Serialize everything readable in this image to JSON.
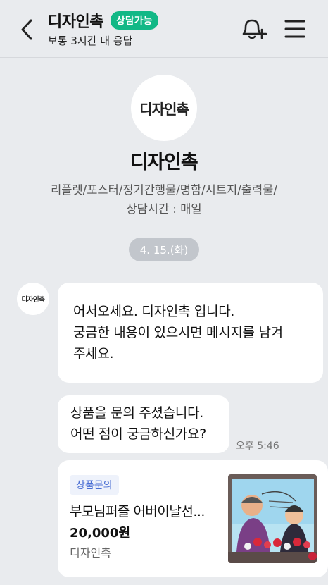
{
  "header": {
    "title": "디자인촉",
    "badge": "상담가능",
    "subtitle": "보통 3시간 내 응답",
    "icons": [
      "back-arrow-icon",
      "bell-plus-icon",
      "hamburger-menu-icon"
    ],
    "accent": "#12b886"
  },
  "profile": {
    "logo_text": "디자인촉",
    "name": "디자인촉",
    "description": "리플렛/포스터/정기간행물/명함/시트지/출력물/",
    "hours": "상담시간 : 매일"
  },
  "date_divider": "4. 15.(화)",
  "messages": [
    {
      "lines": [
        "어서오세요. 디자인촉 입니다.",
        "궁금한 내용이 있으시면 메시지를 남겨",
        "주세요."
      ]
    },
    {
      "lines": [
        "상품을 문의 주셨습니다.",
        "어떤 점이 궁금하신가요?"
      ],
      "time": "오후 5:46"
    }
  ],
  "product_card": {
    "tag": "상품문의",
    "title": "부모님퍼즐 어버이날선...",
    "price": "20,000원",
    "seller": "디자인촉"
  }
}
